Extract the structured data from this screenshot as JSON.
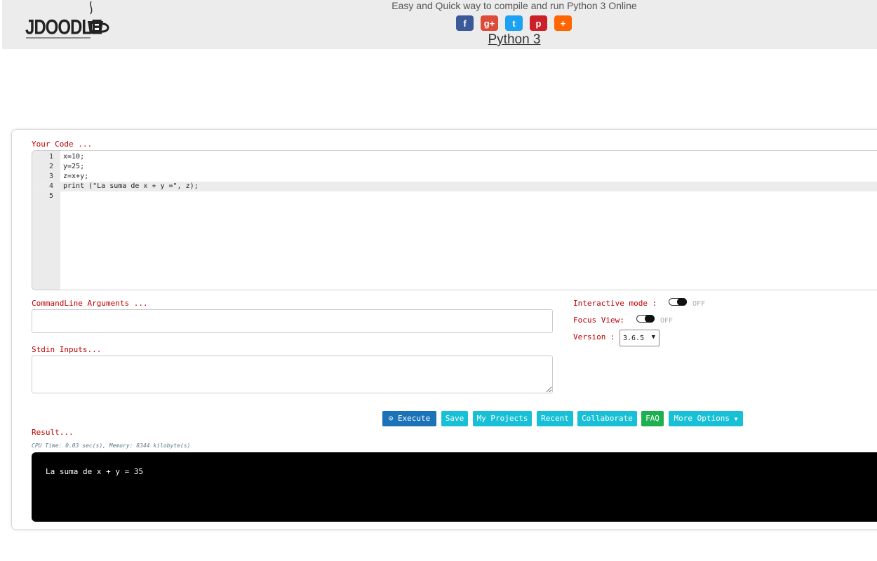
{
  "header": {
    "logo_text": "JDOODLE",
    "tagline": "Easy and Quick way to compile and run Python 3 Online",
    "page_title": "Python 3",
    "social": [
      {
        "name": "facebook",
        "glyph": "f",
        "color": "#3b5998"
      },
      {
        "name": "google-plus",
        "glyph": "g+",
        "color": "#dd4b39"
      },
      {
        "name": "twitter",
        "glyph": "t",
        "color": "#1da1f2"
      },
      {
        "name": "pinterest",
        "glyph": "p",
        "color": "#cb2027"
      },
      {
        "name": "share",
        "glyph": "+",
        "color": "#ff6600"
      }
    ]
  },
  "editor": {
    "label": "Your Code ...",
    "lines": [
      {
        "n": "1",
        "text": "x=10;"
      },
      {
        "n": "2",
        "text": "y=25;"
      },
      {
        "n": "3",
        "text": "z=x+y;"
      },
      {
        "n": "4",
        "text": "print (\"La suma de x + y =\", z);"
      },
      {
        "n": "5",
        "text": ""
      }
    ]
  },
  "args": {
    "label": "CommandLine Arguments ...",
    "value": ""
  },
  "stdin": {
    "label": "Stdin Inputs...",
    "value": ""
  },
  "options": {
    "interactive_label": "Interactive mode :",
    "interactive_state": "OFF",
    "focus_label": "Focus View:",
    "focus_state": "OFF",
    "version_label": "Version :",
    "version_value": "3.6.5"
  },
  "buttons": {
    "execute": "Execute",
    "save": "Save",
    "my_projects": "My Projects",
    "recent": "Recent",
    "collaborate": "Collaborate",
    "faq": "FAQ",
    "more_options": "More Options"
  },
  "result": {
    "label": "Result...",
    "cpu": "CPU Time: 0.03 sec(s), Memory: 8344 kilobyte(s)",
    "output": "La suma de x + y = 35"
  }
}
